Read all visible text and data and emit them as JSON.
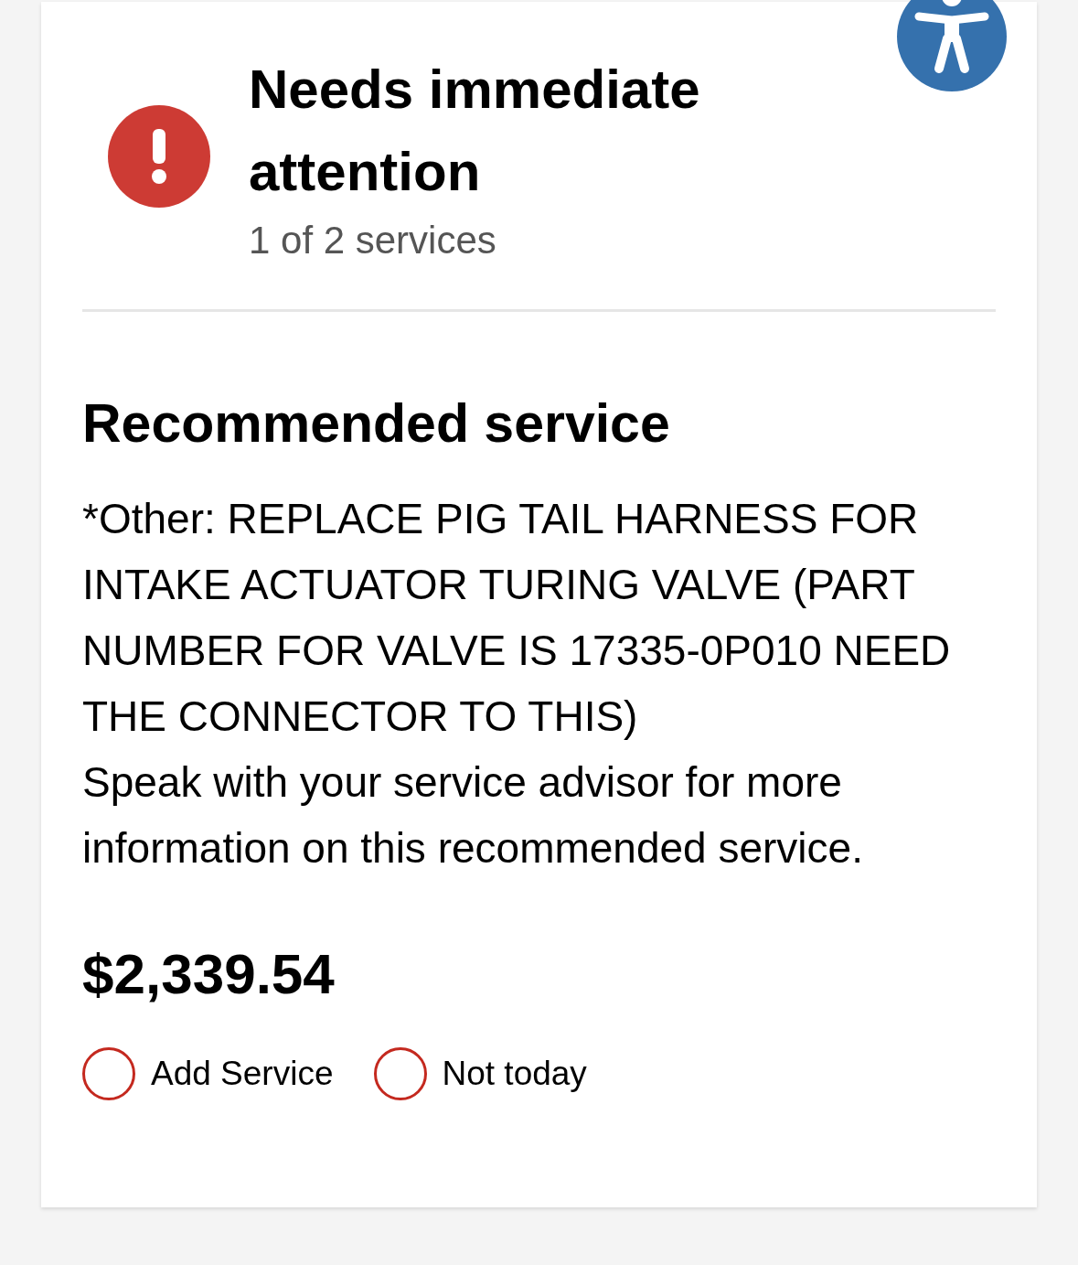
{
  "status": {
    "title": "Needs immediate attention",
    "count": "1 of 2 services"
  },
  "service": {
    "heading": "Recommended service",
    "description": "*Other: REPLACE PIG TAIL HARNESS FOR INTAKE ACTUATOR TURING VALVE (PART NUMBER FOR VALVE IS 17335-0P010 NEED THE CONNECTOR TO THIS)",
    "note": "Speak with your service advisor for more information on this recommended service.",
    "price": "$2,339.54"
  },
  "options": [
    {
      "label": "Add Service",
      "selected": false
    },
    {
      "label": "Not today",
      "selected": false
    }
  ]
}
